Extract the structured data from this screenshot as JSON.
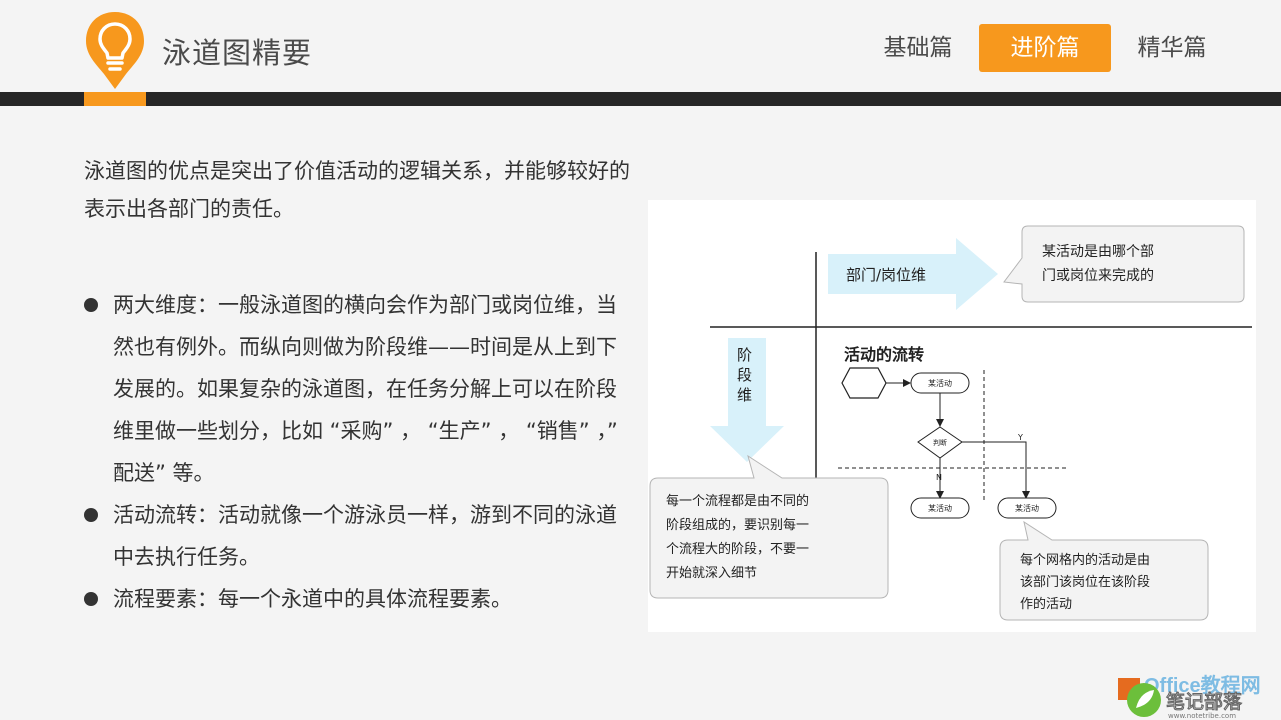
{
  "header": {
    "title": "泳道图精要",
    "nav": [
      "基础篇",
      "进阶篇",
      "精华篇"
    ],
    "active_nav": "进阶篇",
    "accent_color": "#f7981d",
    "bar_color": "#262626"
  },
  "content": {
    "intro": "泳道图的优点是突出了价值活动的逻辑关系，并能够较好的表示出各部门的责任。",
    "bullets": [
      "两大维度：一般泳道图的横向会作为部门或岗位维，当然也有例外。而纵向则做为阶段维——时间是从上到下发展的。如果复杂的泳道图，在任务分解上可以在阶段维里做一些划分，比如 “采购” ， “生产” ， “销售” ，” 配送” 等。",
      "活动流转：活动就像一个游泳员一样，游到不同的泳道中去执行任务。",
      "流程要素：每一个永道中的具体流程要素。"
    ]
  },
  "diagram": {
    "dept_arrow_label": "部门/岗位维",
    "dept_callout": [
      "某活动是由哪个部",
      "门或岗位来完成的"
    ],
    "stage_arrow_label": [
      "阶",
      "段",
      "维"
    ],
    "flow_title": "活动的流转",
    "activity_label": "某活动",
    "decision_label": "判断",
    "yes_label": "Y",
    "no_label": "N",
    "stage_callout": [
      "每一个流程都是由不同的",
      "阶段组成的，要识别每一",
      "个流程大的阶段，不要一",
      "开始就深入细节"
    ],
    "cell_callout": [
      "每个网格内的活动是由",
      "该部门该岗位在该阶段",
      "作的活动"
    ]
  },
  "watermark": {
    "brand": "Office教程网",
    "site_name": "笔记部落",
    "url": "www.notetribe.com"
  }
}
